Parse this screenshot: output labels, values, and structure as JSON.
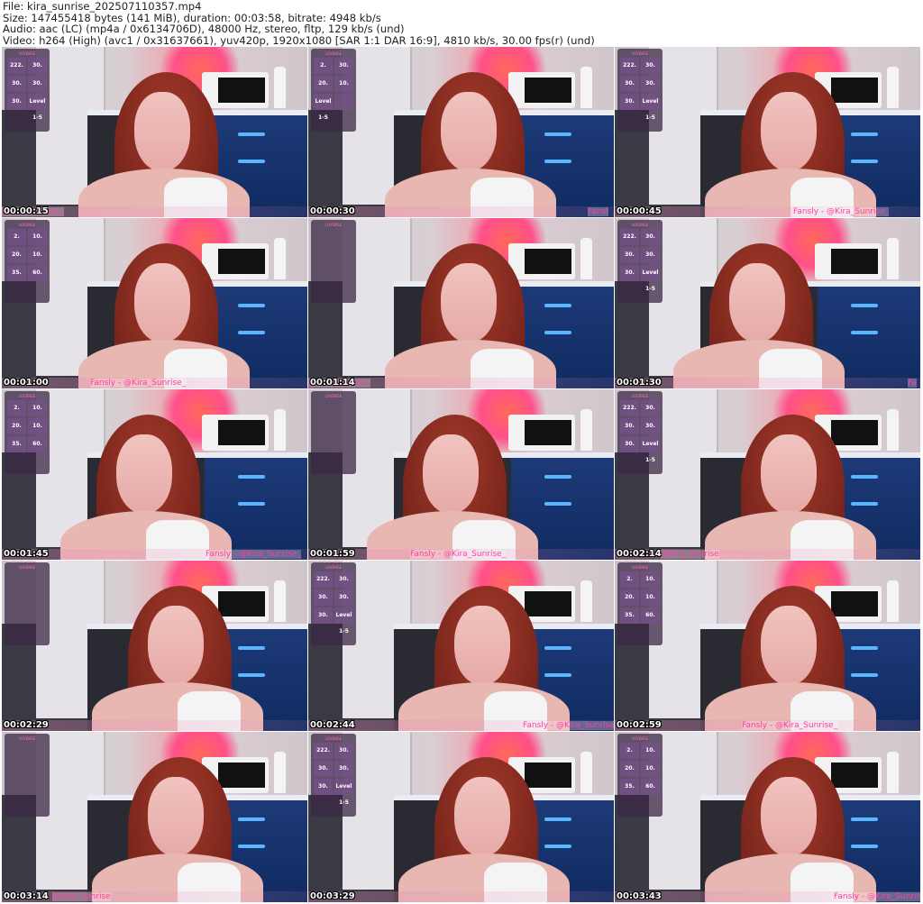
{
  "header": {
    "file": "File: kira_sunrise_202507110357.mp4",
    "size": "Size: 147455418 bytes (141 MiB), duration: 00:03:58, bitrate: 4948 kb/s",
    "audio": "Audio: aac (LC) (mp4a / 0x6134706D), 48000 Hz, stereo, fltp, 129 kb/s (und)",
    "video": "Video: h264 (High) (avc1 / 0x31637661), yuv420p, 1920x1080 [SAR 1:1 DAR 16:9], 4810 kb/s, 30.00 fps(r) (und)"
  },
  "panel_title": "LOVENSE",
  "thumbnails": [
    {
      "time": "00:00:15",
      "overlay": "@Kira_Sunrise_",
      "stats": [
        "222.",
        "30.",
        "30.",
        "30.",
        "30.",
        "Level 1-5"
      ]
    },
    {
      "time": "00:00:30",
      "overlay": "Fansl",
      "stats": [
        "2.",
        "30.",
        "20.",
        "10.",
        "Level 1-5",
        ""
      ]
    },
    {
      "time": "00:00:45",
      "overlay": "Fansly - @Kira_Sunrise_",
      "stats": [
        "222.",
        "30.",
        "30.",
        "30.",
        "30.",
        "Level 1-5"
      ]
    },
    {
      "time": "00:01:00",
      "overlay": "Fansly - @Kira_Sunrise_",
      "stats": [
        "2.",
        "10.",
        "20.",
        "10.",
        "35.",
        "60."
      ]
    },
    {
      "time": "00:01:14",
      "overlay": "@Kira_Sunrise_",
      "stats": [
        "",
        "",
        "",
        "",
        "",
        ""
      ]
    },
    {
      "time": "00:01:30",
      "overlay": "Fa",
      "stats": [
        "222.",
        "30.",
        "30.",
        "30.",
        "30.",
        "Level 1-5"
      ]
    },
    {
      "time": "00:01:45",
      "overlay": "Fansly - @Kira_Sunrise_",
      "stats": [
        "2.",
        "10.",
        "20.",
        "10.",
        "35.",
        "60."
      ]
    },
    {
      "time": "00:01:59",
      "overlay": "Fansly - @Kira_Sunrise_",
      "stats": [
        "",
        "",
        "",
        "",
        "",
        ""
      ]
    },
    {
      "time": "00:02:14",
      "overlay": "@Kira_Sunrise",
      "stats": [
        "222.",
        "30.",
        "30.",
        "30.",
        "30.",
        "Level 1-5"
      ]
    },
    {
      "time": "00:02:29",
      "overlay": "",
      "stats": [
        "",
        "",
        "",
        "",
        "",
        ""
      ]
    },
    {
      "time": "00:02:44",
      "overlay": "Fansly - @Kira_Sunrise_",
      "stats": [
        "222.",
        "30.",
        "30.",
        "30.",
        "30.",
        "Level 1-5"
      ]
    },
    {
      "time": "00:02:59",
      "overlay": "Fansly - @Kira_Sunrise_",
      "stats": [
        "2.",
        "10.",
        "20.",
        "10.",
        "35.",
        "60."
      ]
    },
    {
      "time": "00:03:14",
      "overlay": "@Kira_Sunrise",
      "stats": [
        "",
        "",
        "",
        "",
        "",
        ""
      ]
    },
    {
      "time": "00:03:29",
      "overlay": "",
      "stats": [
        "222.",
        "30.",
        "30.",
        "30.",
        "30.",
        "Level 1-5"
      ]
    },
    {
      "time": "00:03:43",
      "overlay": "Fansly - @Kira_Sunrise",
      "stats": [
        "2.",
        "10.",
        "20.",
        "10.",
        "35.",
        "60."
      ]
    }
  ]
}
